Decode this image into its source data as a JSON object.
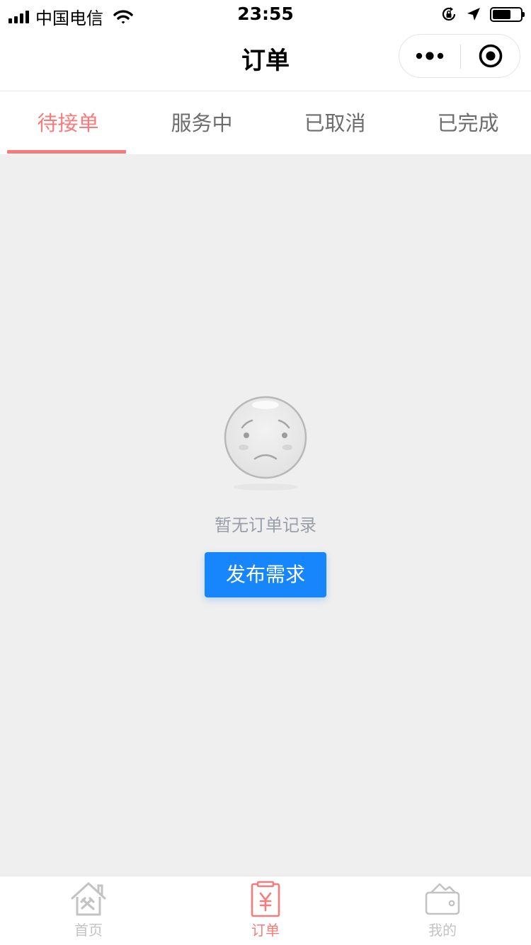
{
  "status_bar": {
    "carrier": "中国电信",
    "time": "23:55",
    "battery_level": 0.65
  },
  "nav": {
    "title": "订单"
  },
  "tabs": [
    {
      "label": "待接单",
      "active": true
    },
    {
      "label": "服务中",
      "active": false
    },
    {
      "label": "已取消",
      "active": false
    },
    {
      "label": "已完成",
      "active": false
    }
  ],
  "empty_state": {
    "message": "暂无订单记录",
    "button_label": "发布需求",
    "icon": "sad-face-icon"
  },
  "bottom_nav": [
    {
      "label": "首页",
      "icon": "home-tools-icon",
      "active": false
    },
    {
      "label": "订单",
      "icon": "order-yen-icon",
      "active": true
    },
    {
      "label": "我的",
      "icon": "wallet-icon",
      "active": false
    }
  ],
  "colors": {
    "accent": "#f77b7b",
    "primary_button": "#1786fd",
    "background": "#efefef",
    "inactive": "#c3c3c3"
  }
}
